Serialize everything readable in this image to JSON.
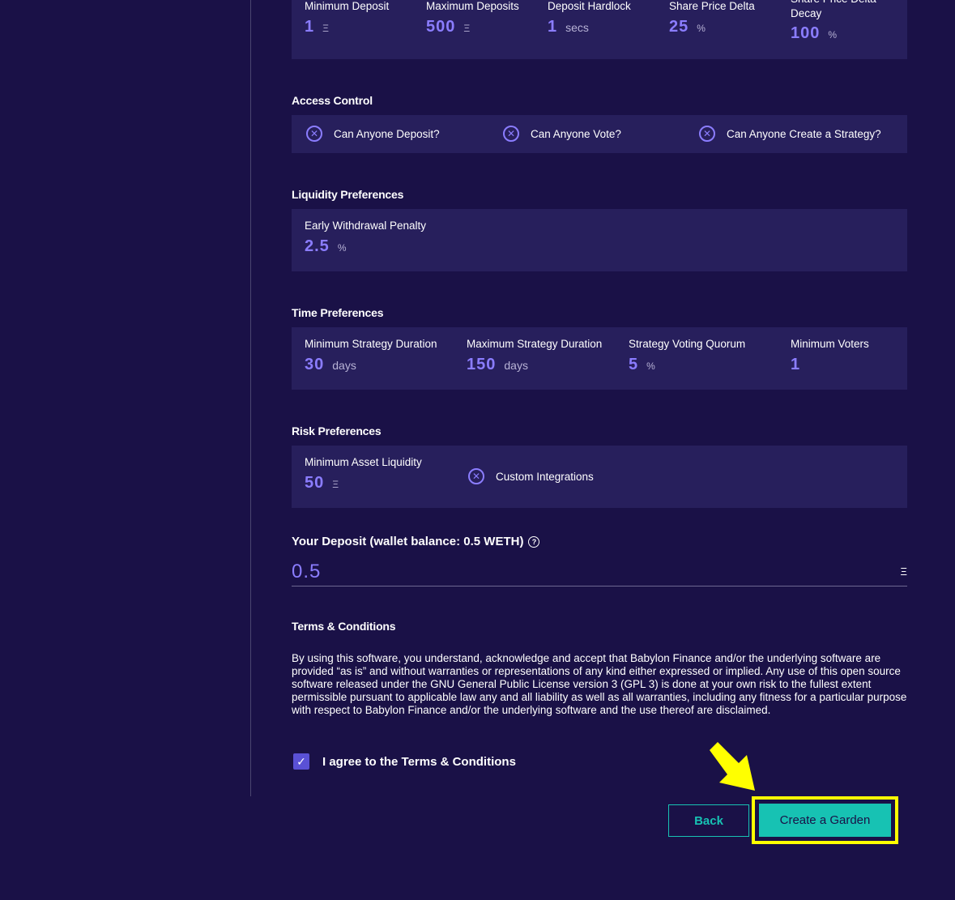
{
  "deposit_params": {
    "min_deposit": {
      "label": "Minimum Deposit",
      "value": "1",
      "unit": "Ξ"
    },
    "max_deposits": {
      "label": "Maximum Deposits",
      "value": "500",
      "unit": "Ξ"
    },
    "deposit_hardlock": {
      "label": "Deposit Hardlock",
      "value": "1",
      "unit": "secs"
    },
    "share_price_delta": {
      "label": "Share Price Delta",
      "value": "25",
      "unit": "%"
    },
    "share_price_delta_decay": {
      "label": "Share Price Delta Decay",
      "value": "100",
      "unit": "%"
    }
  },
  "access_control": {
    "title": "Access Control",
    "items": [
      "Can Anyone Deposit?",
      "Can Anyone Vote?",
      "Can Anyone Create a Strategy?"
    ]
  },
  "liquidity": {
    "title": "Liquidity Preferences",
    "early_withdrawal": {
      "label": "Early Withdrawal Penalty",
      "value": "2.5",
      "unit": "%"
    }
  },
  "time": {
    "title": "Time Preferences",
    "min_duration": {
      "label": "Minimum Strategy Duration",
      "value": "30",
      "unit": "days"
    },
    "max_duration": {
      "label": "Maximum Strategy Duration",
      "value": "150",
      "unit": "days"
    },
    "quorum": {
      "label": "Strategy Voting Quorum",
      "value": "5",
      "unit": "%"
    },
    "min_voters": {
      "label": "Minimum Voters",
      "value": "1"
    }
  },
  "risk": {
    "title": "Risk Preferences",
    "min_liquidity": {
      "label": "Minimum Asset Liquidity",
      "value": "50",
      "unit": "Ξ"
    },
    "custom_integrations": "Custom Integrations"
  },
  "deposit": {
    "label": "Your Deposit (wallet balance: 0.5 WETH)",
    "help_icon": "?",
    "value": "0.5",
    "unit": "Ξ"
  },
  "terms": {
    "title": "Terms & Conditions",
    "text": "By using this software, you understand, acknowledge and accept that Babylon Finance and/or the underlying software are provided “as is” and without warranties or representations of any kind either expressed or implied. Any use of this open source software released under the GNU General Public License version 3 (GPL 3) is done at your own risk to the fullest extent permissible pursuant to applicable law any and all liability as well as all warranties, including any fitness for a particular purpose with respect to Babylon Finance and/or the underlying software and the use thereof are disclaimed.",
    "agree_label": "I agree to the Terms & Conditions"
  },
  "buttons": {
    "back": "Back",
    "create": "Create a Garden"
  },
  "colors": {
    "background": "#1a1147",
    "panel": "#271f5c",
    "accent": "#8b7dff",
    "teal": "#17c2b3",
    "highlight": "#ffff00"
  }
}
